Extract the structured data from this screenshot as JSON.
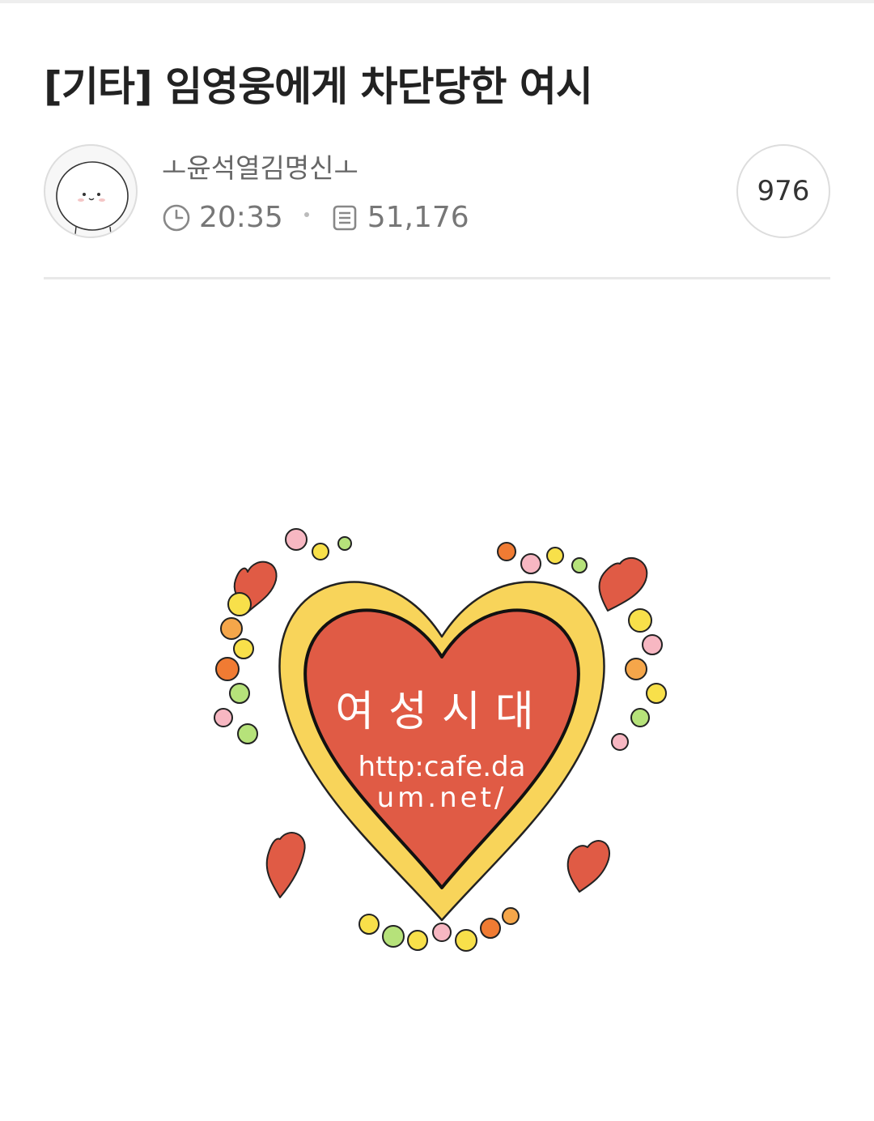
{
  "post": {
    "title": "[기타] 임영웅에게 차단당한 여시",
    "author": "ㅗ윤석열김명신ㅗ",
    "time": "20:35",
    "views": "51,176",
    "comment_count": "976"
  },
  "image": {
    "heart_text": "여성시대",
    "url_line1": "http:cafe.da",
    "url_line2": "um.net/"
  },
  "icons": {
    "avatar": "cat-face-avatar",
    "time": "clock-icon",
    "views": "document-icon"
  },
  "colors": {
    "heart_red": "#e05b45",
    "heart_border_yellow": "#f8d45a",
    "text_dark": "#222222",
    "text_muted": "#777777"
  }
}
